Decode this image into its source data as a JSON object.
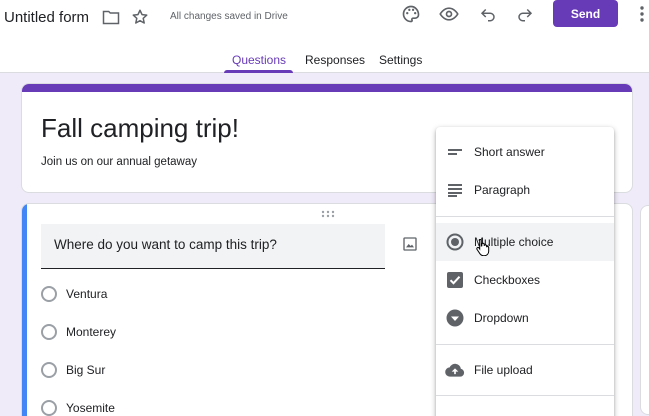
{
  "header": {
    "title": "Untitled form",
    "saved_status": "All changes saved in Drive",
    "send_label": "Send"
  },
  "tabs": [
    {
      "label": "Questions",
      "active": true
    },
    {
      "label": "Responses",
      "active": false
    },
    {
      "label": "Settings",
      "active": false
    }
  ],
  "form": {
    "title": "Fall camping trip!",
    "description": "Join us on our annual getaway"
  },
  "question": {
    "text": "Where do you want to camp this trip?",
    "options": [
      "Ventura",
      "Monterey",
      "Big Sur",
      "Yosemite"
    ]
  },
  "menu": {
    "items": [
      {
        "label": "Short answer",
        "icon": "short-answer-icon"
      },
      {
        "label": "Paragraph",
        "icon": "paragraph-icon"
      },
      {
        "label": "Multiple choice",
        "icon": "radio-button-icon"
      },
      {
        "label": "Checkboxes",
        "icon": "checkbox-icon"
      },
      {
        "label": "Dropdown",
        "icon": "dropdown-icon"
      },
      {
        "label": "File upload",
        "icon": "cloud-upload-icon"
      }
    ]
  },
  "colors": {
    "accent": "#673ab7",
    "background": "#f0ebf8",
    "active_question": "#4285f4"
  }
}
